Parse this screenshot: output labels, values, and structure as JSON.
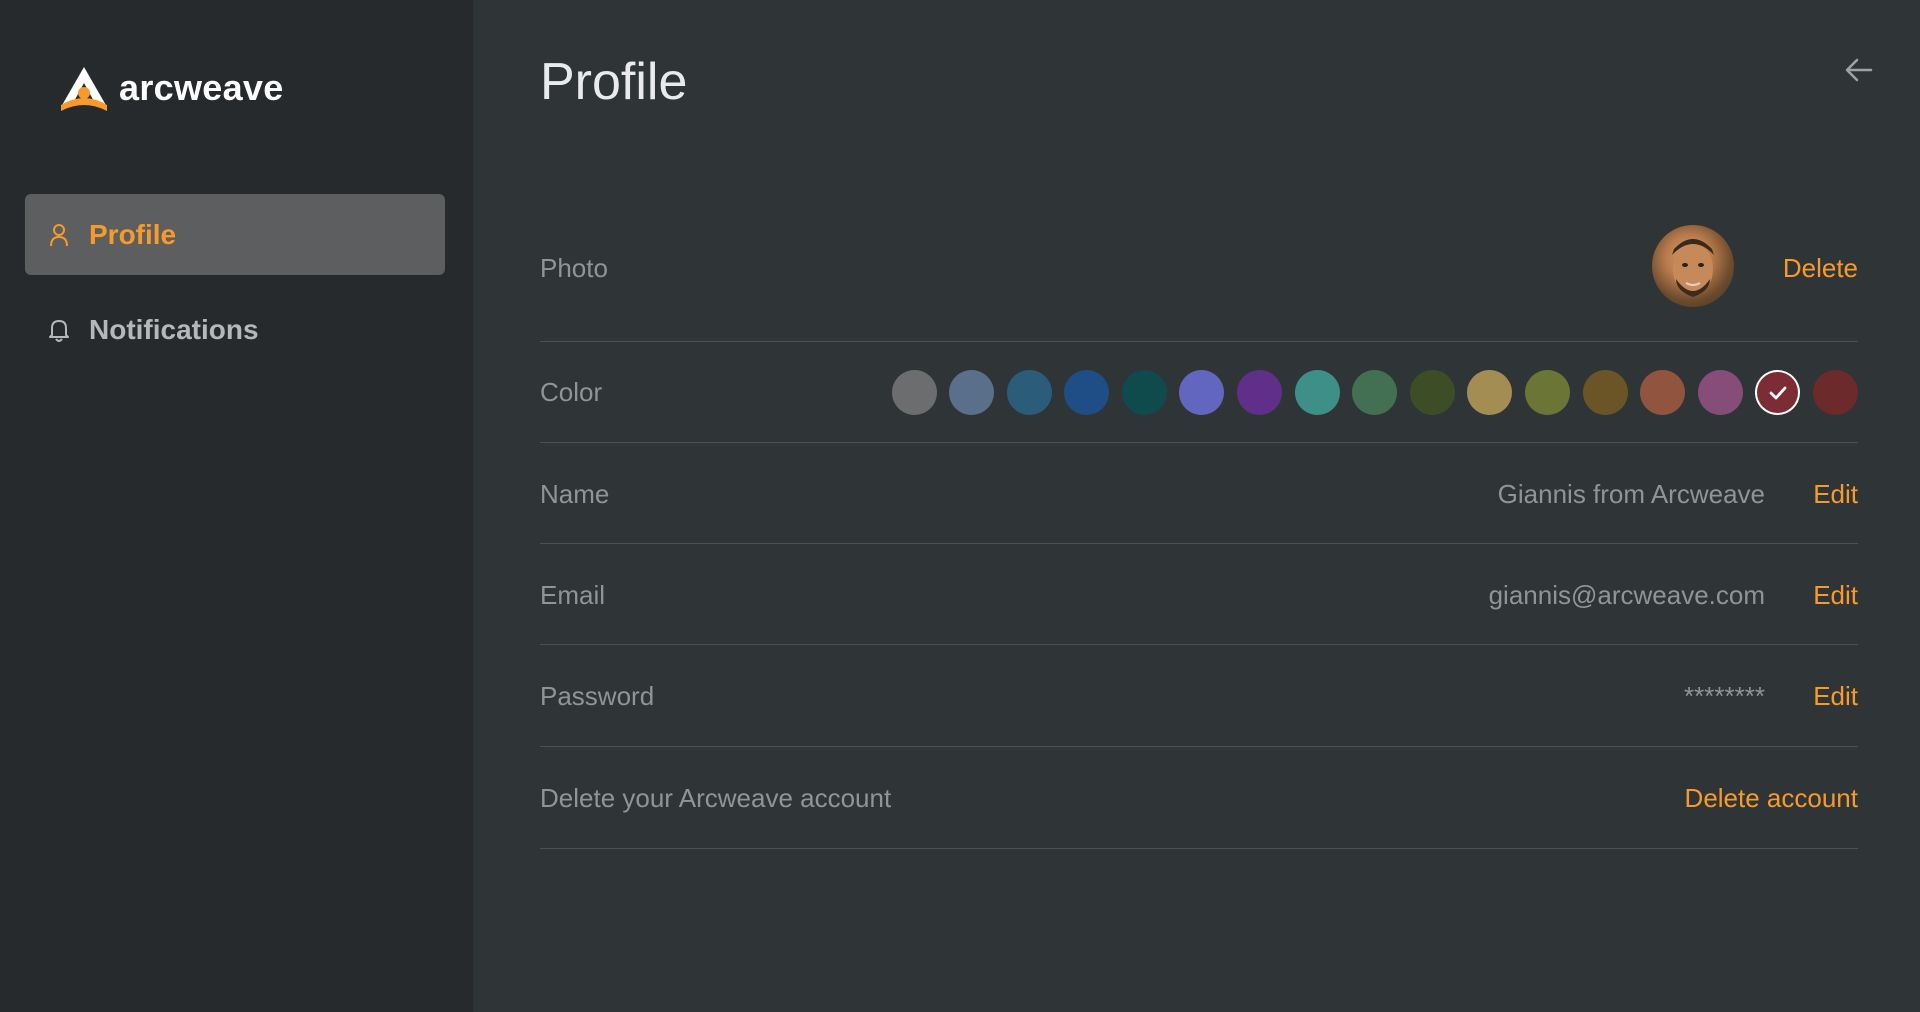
{
  "app": {
    "name": "arcweave",
    "accent_color": "#f79a2b"
  },
  "sidebar": {
    "items": [
      {
        "label": "Profile",
        "icon": "user-icon",
        "active": true
      },
      {
        "label": "Notifications",
        "icon": "bell-icon",
        "active": false
      }
    ]
  },
  "main": {
    "title": "Profile",
    "back_icon": "arrow-left-icon",
    "photo": {
      "label": "Photo",
      "action": "Delete"
    },
    "color": {
      "label": "Color",
      "swatches": [
        "#6b6d6e",
        "#5a6f8a",
        "#2b5c7a",
        "#1f4d85",
        "#0f4a4c",
        "#6266bf",
        "#5f2f8a",
        "#3f8f89",
        "#437052",
        "#3d4d26",
        "#a48d52",
        "#6b7536",
        "#6b5526",
        "#91553f",
        "#864d79",
        "#7b2c34",
        "#6c2a2a"
      ],
      "selected_index": 15
    },
    "name": {
      "label": "Name",
      "value": "Giannis from Arcweave",
      "action": "Edit"
    },
    "email": {
      "label": "Email",
      "value": "giannis@arcweave.com",
      "action": "Edit"
    },
    "password": {
      "label": "Password",
      "value": "********",
      "action": "Edit"
    },
    "delete_account": {
      "label": "Delete your Arcweave account",
      "action": "Delete account"
    }
  }
}
